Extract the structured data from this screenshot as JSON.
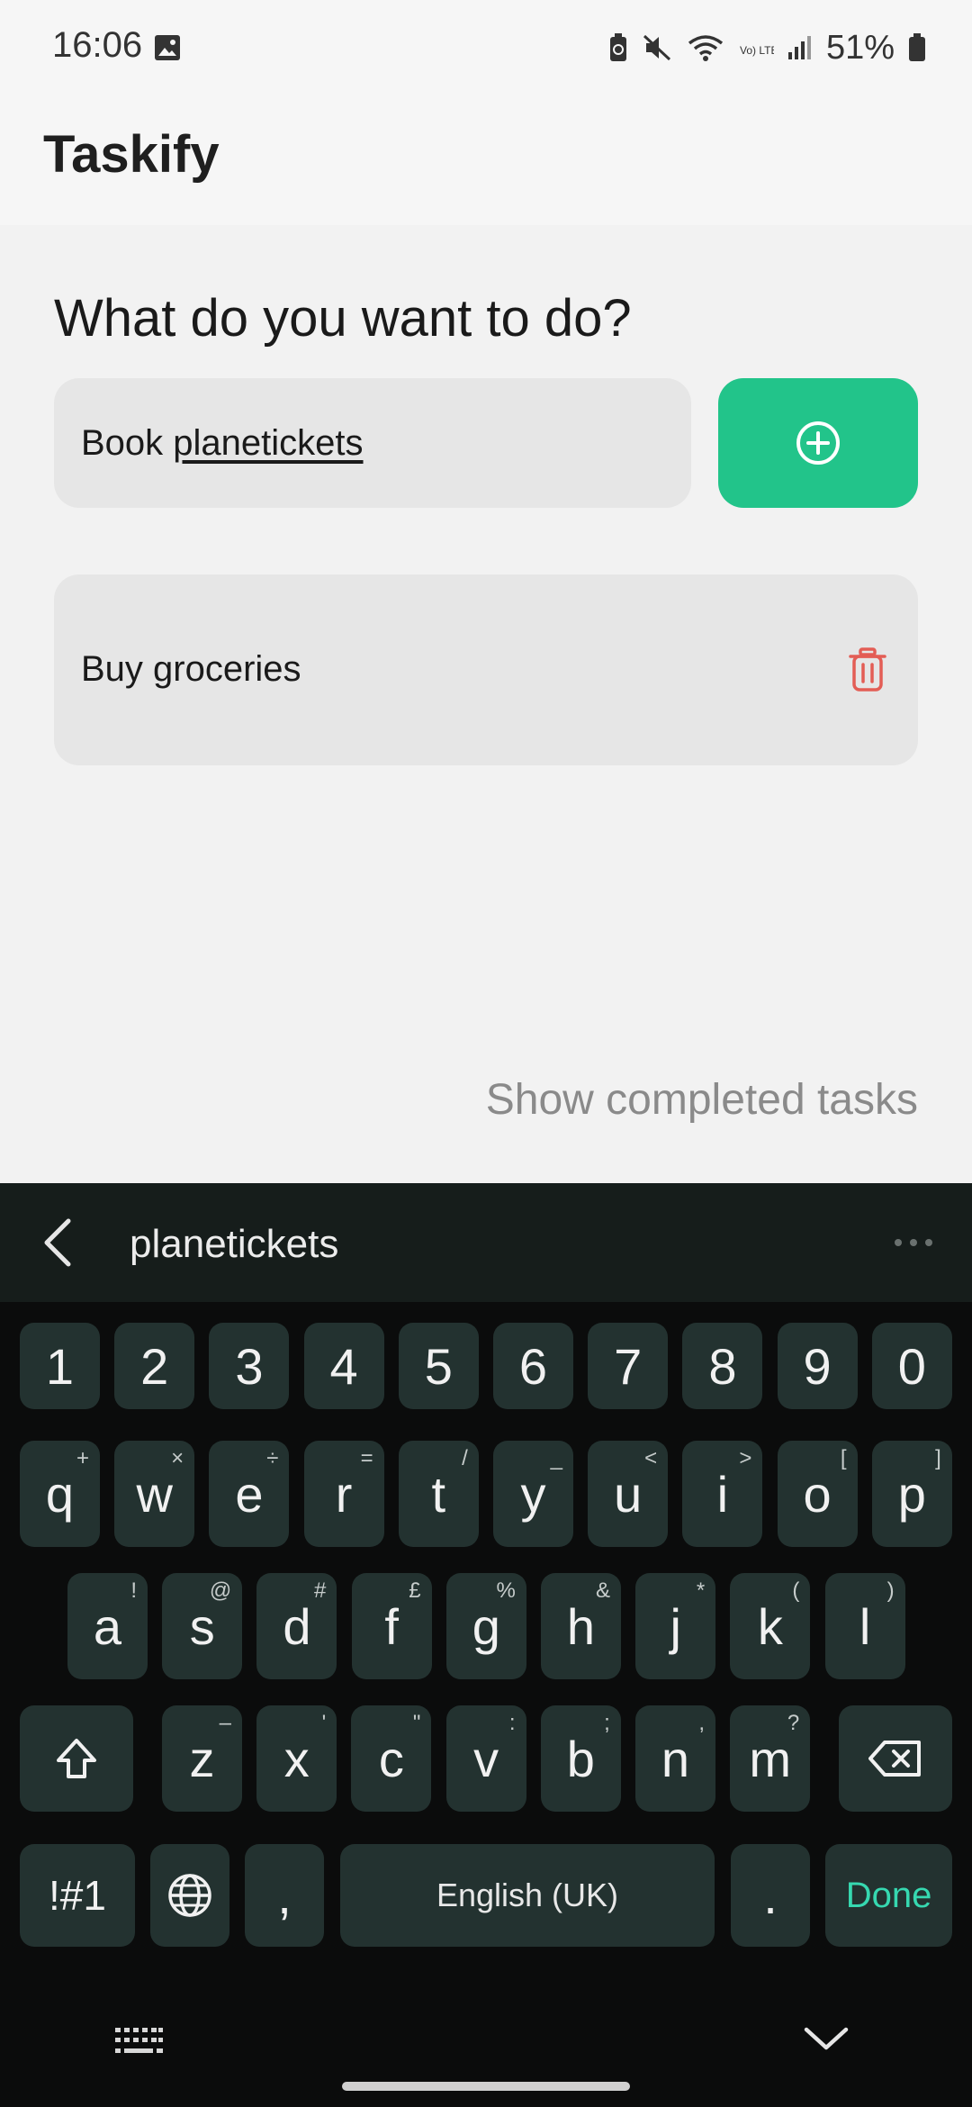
{
  "status_bar": {
    "time": "16:06",
    "battery": "51%",
    "network_label": "Vo) LTE1",
    "icons": [
      "gallery-icon",
      "battery-saver-icon",
      "mute-icon",
      "wifi-icon",
      "lte-icon",
      "signal-icon",
      "battery-icon"
    ]
  },
  "app": {
    "title": "Taskify",
    "accent_color": "#22c48a"
  },
  "main": {
    "prompt": "What do you want to do?",
    "input_prefix": "Book ",
    "input_suggestion": "planetickets",
    "tasks": [
      {
        "text": "Buy groceries"
      }
    ],
    "show_completed_label": "Show completed tasks"
  },
  "keyboard": {
    "suggestion": "planetickets",
    "row_numbers": [
      "1",
      "2",
      "3",
      "4",
      "5",
      "6",
      "7",
      "8",
      "9",
      "0"
    ],
    "row1": [
      {
        "k": "q",
        "h": "+"
      },
      {
        "k": "w",
        "h": "×"
      },
      {
        "k": "e",
        "h": "÷"
      },
      {
        "k": "r",
        "h": "="
      },
      {
        "k": "t",
        "h": "/"
      },
      {
        "k": "y",
        "h": "_"
      },
      {
        "k": "u",
        "h": "<"
      },
      {
        "k": "i",
        "h": ">"
      },
      {
        "k": "o",
        "h": "["
      },
      {
        "k": "p",
        "h": "]"
      }
    ],
    "row2": [
      {
        "k": "a",
        "h": "!"
      },
      {
        "k": "s",
        "h": "@"
      },
      {
        "k": "d",
        "h": "#"
      },
      {
        "k": "f",
        "h": "£"
      },
      {
        "k": "g",
        "h": "%"
      },
      {
        "k": "h",
        "h": "&"
      },
      {
        "k": "j",
        "h": "*"
      },
      {
        "k": "k",
        "h": "("
      },
      {
        "k": "l",
        "h": ")"
      }
    ],
    "row3": [
      {
        "k": "z",
        "h": "–"
      },
      {
        "k": "x",
        "h": "'"
      },
      {
        "k": "c",
        "h": "\""
      },
      {
        "k": "v",
        "h": ":"
      },
      {
        "k": "b",
        "h": ";"
      },
      {
        "k": "n",
        "h": ","
      },
      {
        "k": "m",
        "h": "?"
      }
    ],
    "symbols_label": "!#1",
    "comma_label": ",",
    "space_label": "English (UK)",
    "period_label": ".",
    "done_label": "Done",
    "done_color": "#36d8b0"
  }
}
